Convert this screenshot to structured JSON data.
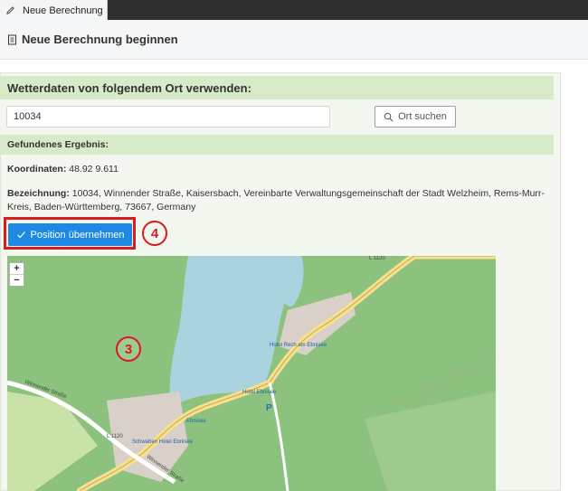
{
  "tab": {
    "label": "Neue Berechnung",
    "icon": "pencil-icon"
  },
  "header": {
    "title": "Neue Berechnung beginnen",
    "icon": "document-icon"
  },
  "weather": {
    "heading": "Wetterdaten von folgendem Ort verwenden:",
    "input_value": "10034",
    "search_label": "Ort suchen",
    "result_heading": "Gefundenes Ergebnis:",
    "coords_label": "Koordinaten:",
    "coords_value": "48.92 9.611",
    "bez_label": "Bezeichnung:",
    "bez_value": "10034, Winnender Straße, Kaisersbach, Vereinbarte Verwaltungsgemeinschaft der Stadt Welzheim, Rems-Murr-Kreis, Baden-Württemberg, 73667, Germany",
    "apply_label": "Position übernehmen"
  },
  "callouts": {
    "four": "4",
    "three": "3"
  },
  "map": {
    "zoom_in": "+",
    "zoom_out": "−",
    "labels": {
      "road_l1120_top": "L 1120",
      "road_l1120_left": "L 1120",
      "street_winnender_left": "Winnender Straße",
      "street_winnender_bottom": "Winnender Straße",
      "hotel_ebnisee": "Hotel Ebnisee",
      "hotel_schwaben": "Schwaben Hotel Ebnisee",
      "hotel_rech": "Hotel Rech am Ebnisee",
      "ebnisee": "Ebnisee",
      "parking": "P"
    }
  },
  "colors": {
    "accent": "#1e88e5",
    "callout": "#d91c1c",
    "band": "#d7ebc8",
    "water": "#aad3df",
    "forest": "#8cc27e"
  }
}
